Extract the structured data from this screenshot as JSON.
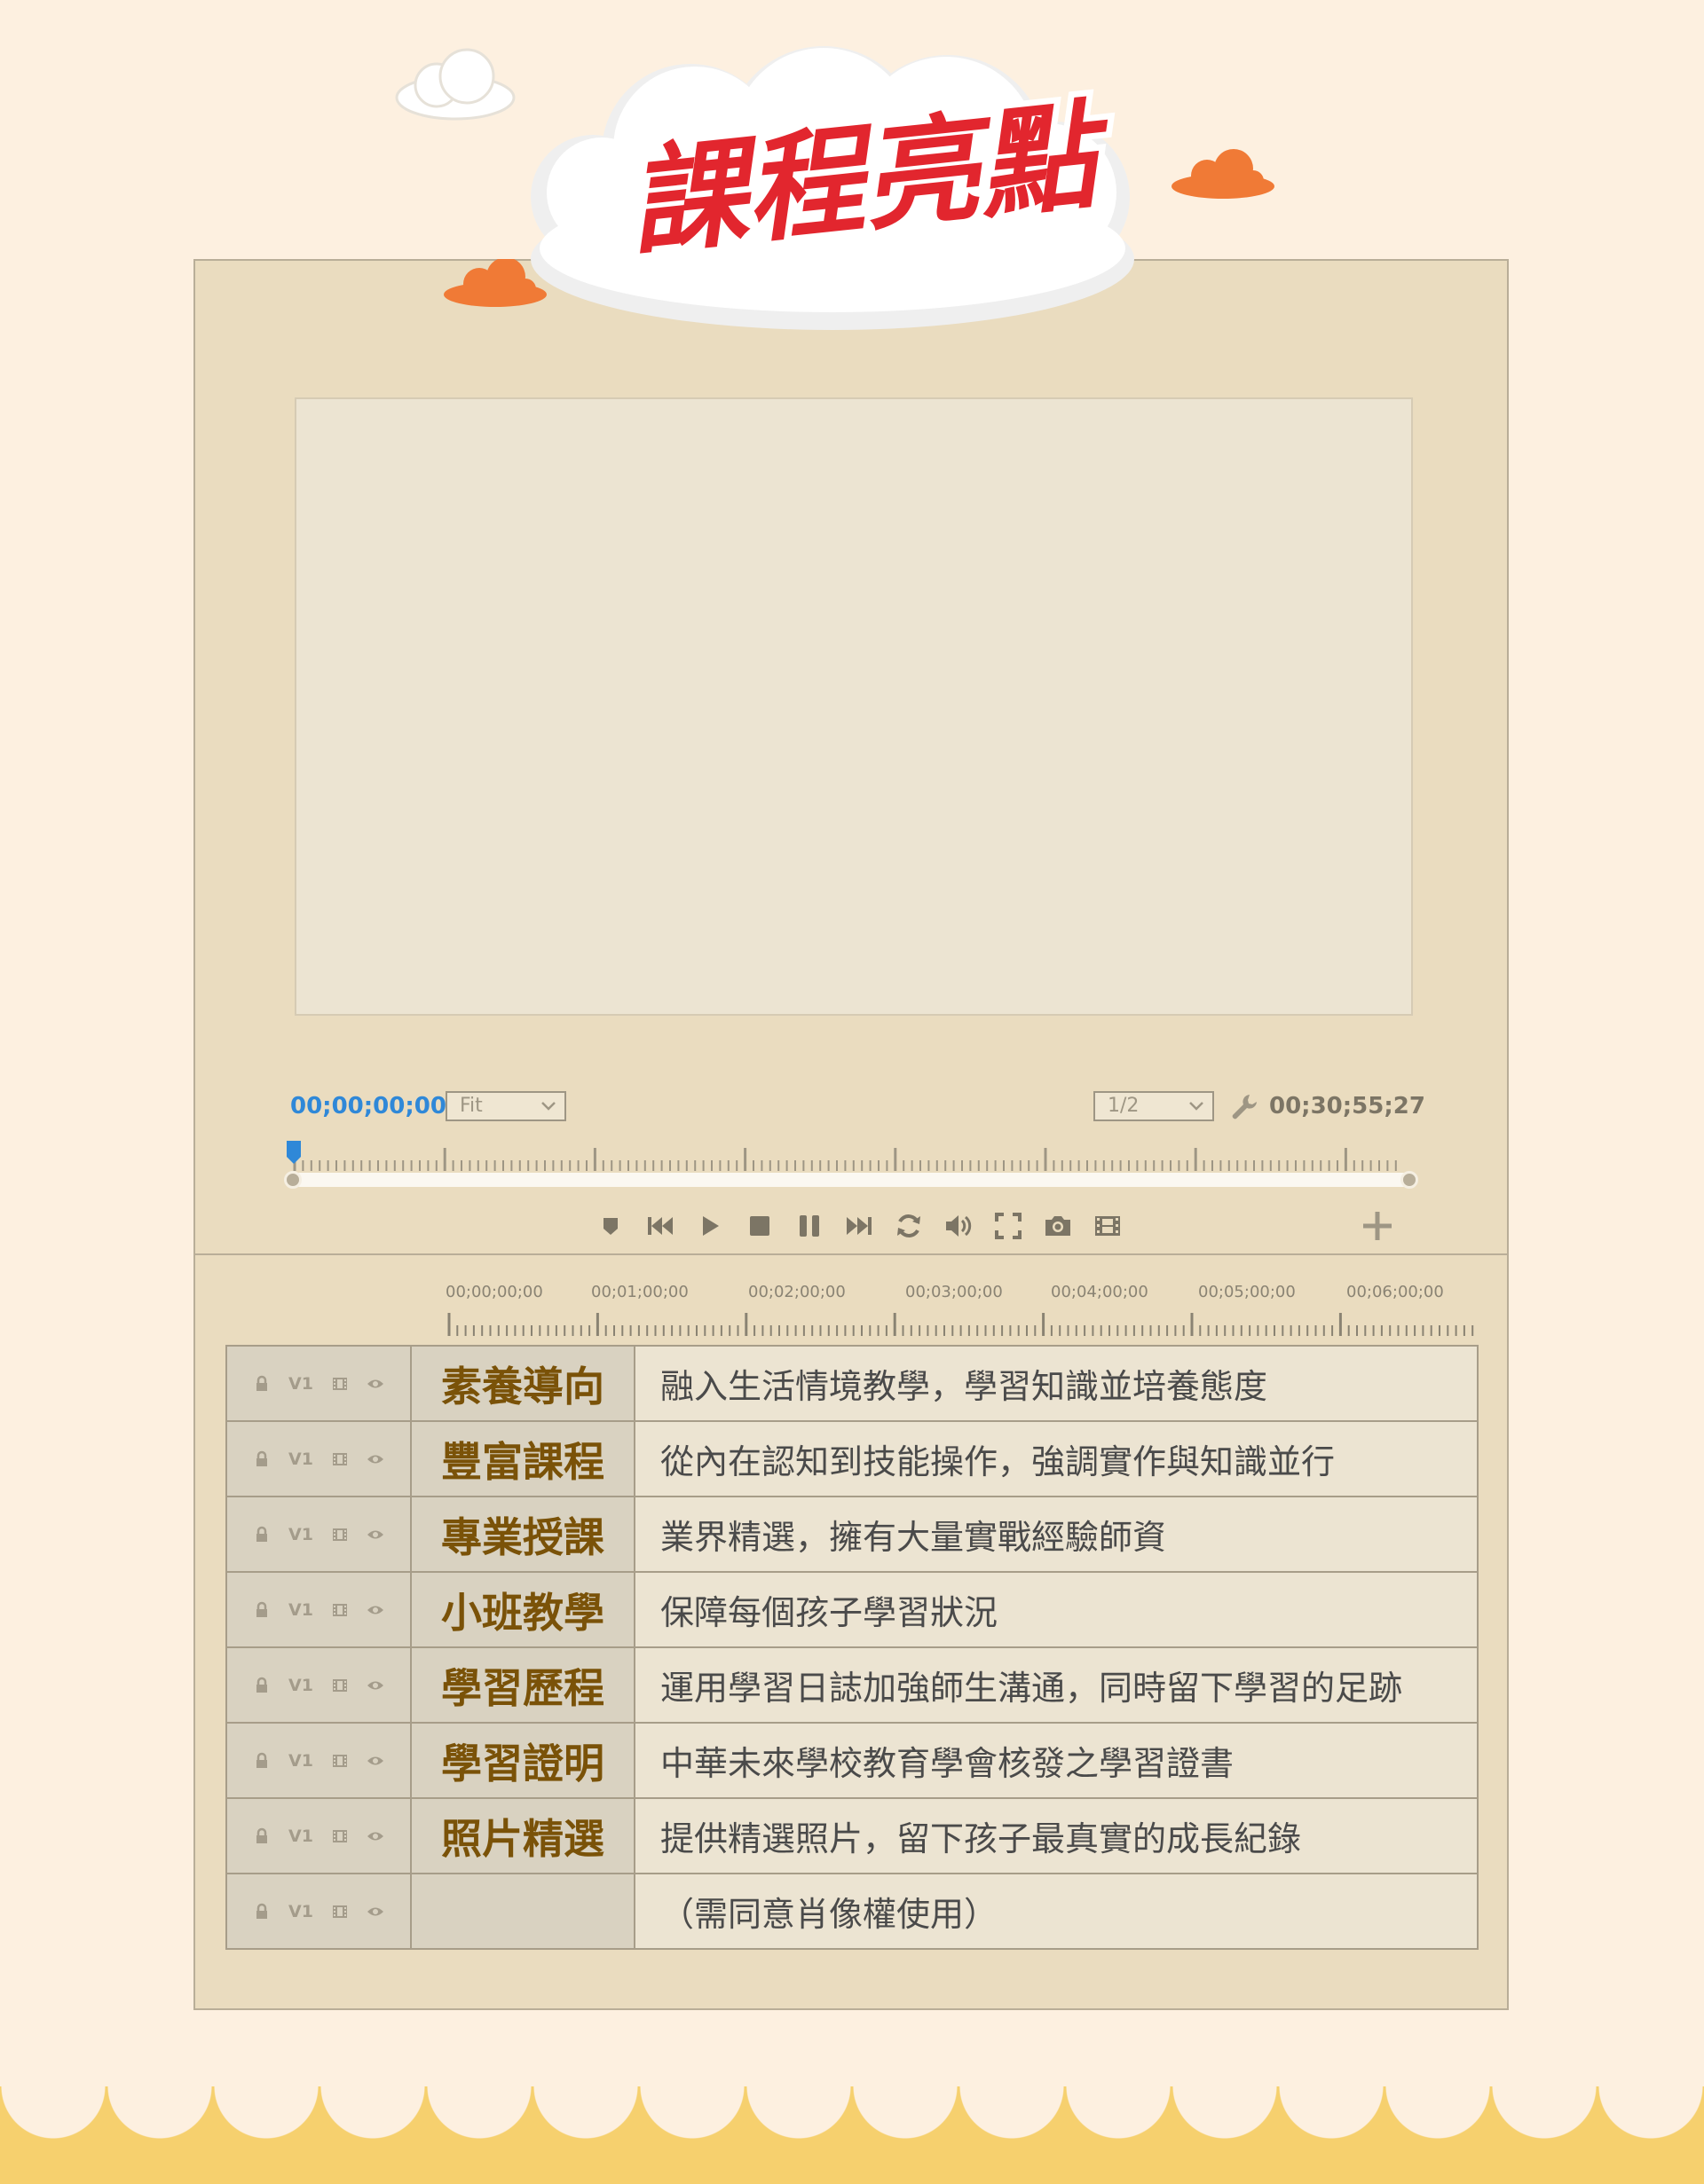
{
  "title": "課程亮點",
  "player": {
    "current_timecode": "00;00;00;00",
    "end_timecode": "00;30;55;27",
    "zoom_select": "Fit",
    "resolution_select": "1/2",
    "playhead_progress": 0
  },
  "timeline": {
    "labels": [
      "00;00;00;00",
      "00;01;00;00",
      "00;02;00;00",
      "00;03;00;00",
      "00;04;00;00",
      "00;05;00;00",
      "00;06;00;00"
    ]
  },
  "tracks": [
    {
      "track_label": "V1",
      "name": "素養導向",
      "description": "融入生活情境教學，學習知識並培養態度"
    },
    {
      "track_label": "V1",
      "name": "豐富課程",
      "description": "從內在認知到技能操作，強調實作與知識並行"
    },
    {
      "track_label": "V1",
      "name": "專業授課",
      "description": "業界精選，擁有大量實戰經驗師資"
    },
    {
      "track_label": "V1",
      "name": "小班教學",
      "description": "保障每個孩子學習狀況"
    },
    {
      "track_label": "V1",
      "name": "學習歷程",
      "description": "運用學習日誌加強師生溝通，同時留下學習的足跡"
    },
    {
      "track_label": "V1",
      "name": "學習證明",
      "description": "中華未來學校教育學會核發之學習證書"
    },
    {
      "track_label": "V1",
      "name": "照片精選",
      "description": "提供精選照片，留下孩子最真實的成長紀錄"
    },
    {
      "track_label": "V1",
      "name": "",
      "description": "（需同意肖像權使用）"
    }
  ],
  "colors": {
    "page_bg": "#fdf0e0",
    "panel_bg": "#eadcbf",
    "title_red": "#e2262e",
    "accent_blue": "#2f88d8",
    "cloud_orange": "#f07a36",
    "track_name_text": "#7a5208",
    "scallop": "#f6d06e"
  }
}
